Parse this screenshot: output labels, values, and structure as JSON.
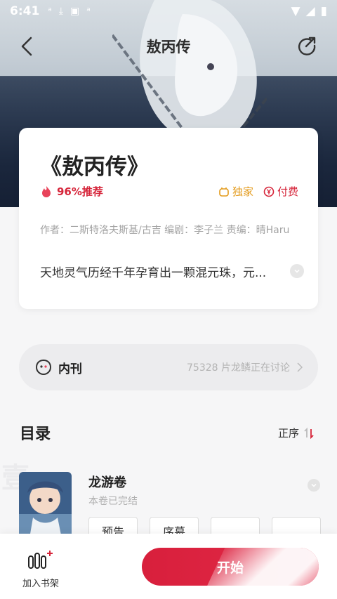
{
  "status_bar": {
    "time": "6:41"
  },
  "nav": {
    "title": "敖丙传"
  },
  "book": {
    "title": "《敖丙传》",
    "recommend": "96%推荐",
    "tag_exclusive": "独家",
    "tag_paid": "付费",
    "credits": "作者：二斯特洛夫斯基/古吉  编剧：李子兰  责编：晴Haru",
    "description": "天地灵气历经千年孕育出一颗混元珠，元..."
  },
  "neikan": {
    "label": "内刊",
    "discussion": "75328 片龙鳞正在讨论"
  },
  "catalog": {
    "title": "目录",
    "sort_label": "正序",
    "watermark": "壹",
    "volume": {
      "name": "龙游卷",
      "status": "本卷已完结",
      "chapters": [
        "预告",
        "序幕",
        "",
        ""
      ]
    }
  },
  "bottom": {
    "shelf_label": "加入书架",
    "start_label": "开始"
  },
  "colors": {
    "accent": "#d81f3c",
    "exclusive": "#e39a1a"
  }
}
